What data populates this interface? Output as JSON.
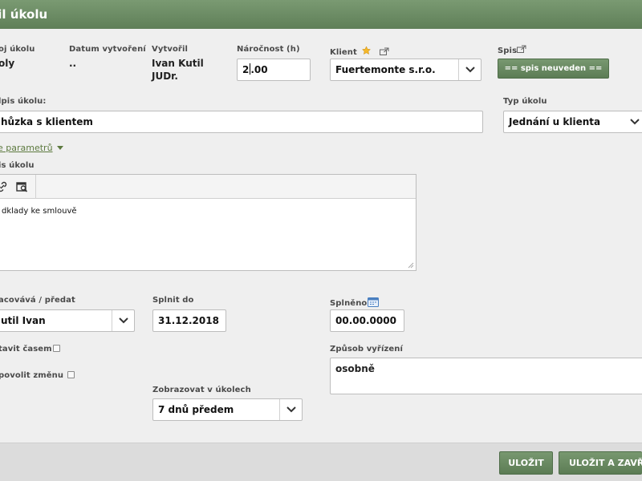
{
  "window": {
    "title": "tail úkolu"
  },
  "fields": {
    "task_no_label": "oj úkolu",
    "task_no_value": "oly",
    "created_date_label": "Datum vytvoření",
    "created_date_value": "..",
    "created_by_label": "Vytvořil",
    "created_by_line1": "Ivan Kutil",
    "created_by_line2": "JUDr.",
    "effort_label": "Náročnost (h)",
    "effort_value_a": "2",
    "effort_value_b": ".00",
    "client_label": "Klient",
    "client_value": "Fuertemonte s.r.o.",
    "file_label": "Spis",
    "file_button": "== spis neuveden ==",
    "task_title_label": "lpis úkolu:",
    "task_title_value": "hůzka s klientem",
    "task_type_label": "Typ úkolu",
    "task_type_value": "Jednání u klienta",
    "params_link": "e parametrů",
    "description_label": "is úkolu",
    "description_text": "dklady ke smlouvě",
    "assignee_label": "acovává / předat",
    "assignee_value": "util Ivan",
    "due_label": "Splnit do",
    "due_value": "31.12.2018",
    "done_label": "Splněno",
    "done_value": "00.00.0000",
    "stop_by_time_label": "tavit časem",
    "allow_change_label": "povolit změnu",
    "resolution_label": "Způsob vyřízení",
    "resolution_value": "osobně",
    "show_in_tasks_label": "Zobrazovat v úkolech",
    "show_in_tasks_value": "7 dnů předem"
  },
  "footer": {
    "save_label": "ULOŽIT",
    "save_close_label": "ULOŽIT A ZAVŘÍT"
  },
  "colors": {
    "accent": "#6b8b63",
    "link": "#5d7a3f"
  }
}
